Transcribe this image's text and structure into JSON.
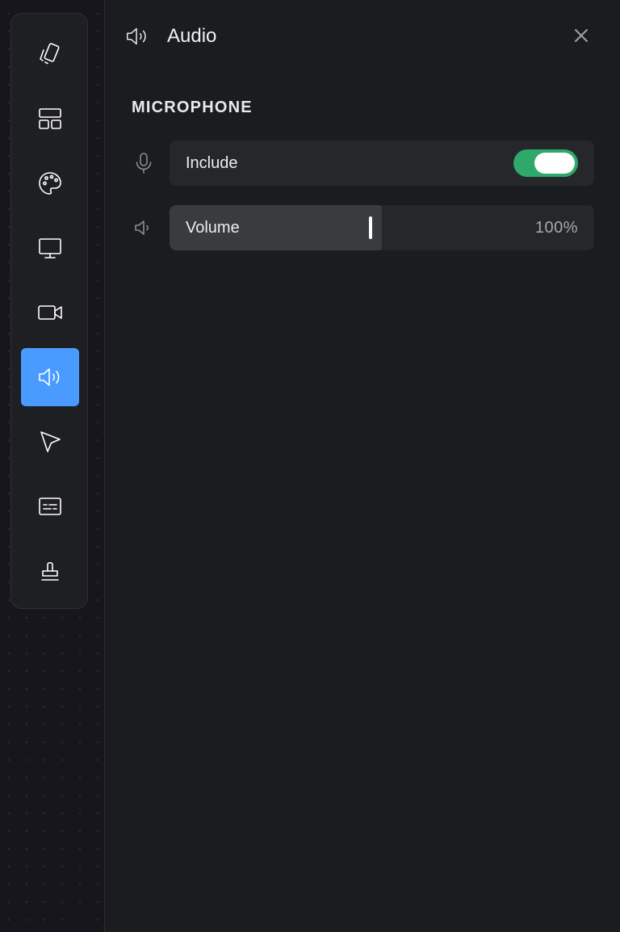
{
  "panel": {
    "title": "Audio",
    "header_icon": "speaker-icon",
    "close_icon": "close-icon"
  },
  "toolbar": {
    "active_index": 5,
    "items": [
      {
        "name": "tool-background",
        "icon": "cards-icon"
      },
      {
        "name": "tool-layout",
        "icon": "layout-icon"
      },
      {
        "name": "tool-style",
        "icon": "palette-icon"
      },
      {
        "name": "tool-screen",
        "icon": "monitor-icon"
      },
      {
        "name": "tool-camera",
        "icon": "video-camera-icon"
      },
      {
        "name": "tool-audio",
        "icon": "speaker-icon"
      },
      {
        "name": "tool-cursor",
        "icon": "cursor-icon"
      },
      {
        "name": "tool-captions",
        "icon": "captions-icon"
      },
      {
        "name": "tool-watermark",
        "icon": "stamp-icon"
      }
    ]
  },
  "microphone": {
    "section_title": "MICROPHONE",
    "include": {
      "label": "Include",
      "icon": "microphone-icon",
      "enabled": true
    },
    "volume": {
      "label": "Volume",
      "icon": "speaker-low-icon",
      "value_text": "100%",
      "level": 0.5
    }
  },
  "colors": {
    "accent": "#4a9bff",
    "toggle_on": "#2ea86b",
    "panel_bg": "#1b1c1f",
    "row_bg": "#26272b"
  }
}
